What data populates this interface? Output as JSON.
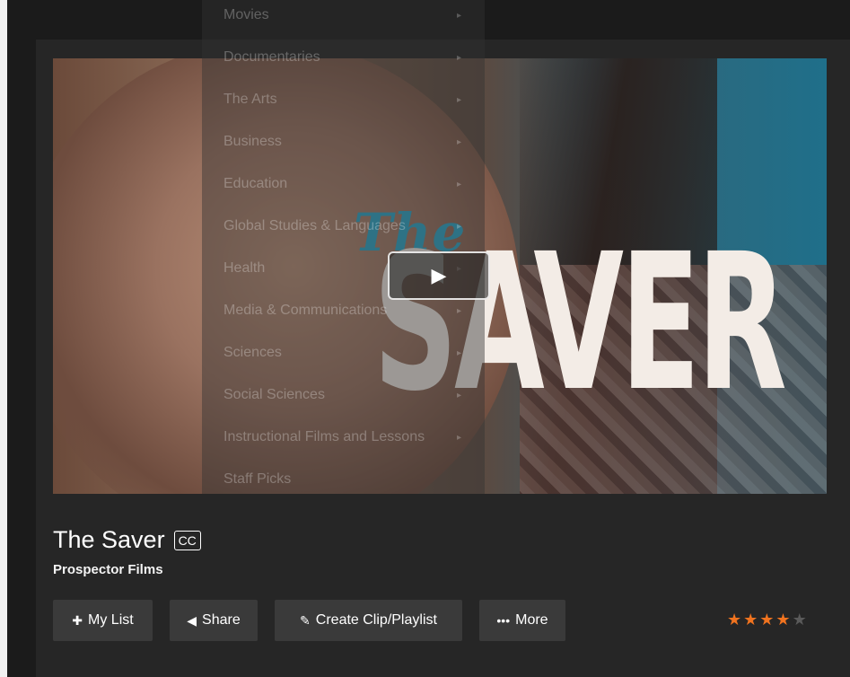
{
  "menu": {
    "items": [
      {
        "label": "Movies"
      },
      {
        "label": "Documentaries"
      },
      {
        "label": "The Arts"
      },
      {
        "label": "Business"
      },
      {
        "label": "Education"
      },
      {
        "label": "Global Studies & Languages"
      },
      {
        "label": "Health"
      },
      {
        "label": "Media & Communications"
      },
      {
        "label": "Sciences"
      },
      {
        "label": "Social Sciences"
      },
      {
        "label": "Instructional Films and Lessons"
      },
      {
        "label": "Staff Picks"
      }
    ],
    "arrow_glyph": "▸"
  },
  "poster": {
    "title_script": "The",
    "title_main": "SAVER"
  },
  "video": {
    "title": "The Saver",
    "cc_badge": "CC",
    "subtitle": "Prospector Films",
    "play_icon": "play-icon",
    "play_glyph": "▶"
  },
  "actions": {
    "my_list": {
      "label": "My List",
      "icon": "plus-icon",
      "glyph": "✚"
    },
    "share": {
      "label": "Share",
      "icon": "share-icon",
      "glyph": "◀"
    },
    "create_clip": {
      "label": "Create Clip/Playlist",
      "icon": "edit-icon",
      "glyph": "✎"
    },
    "more": {
      "label": "More",
      "icon": "ellipsis-icon",
      "glyph": "•••"
    }
  },
  "rating": {
    "value": 4,
    "max": 5,
    "star_glyph": "★",
    "active_color": "#f0731f",
    "inactive_color": "#5a5a5a"
  }
}
